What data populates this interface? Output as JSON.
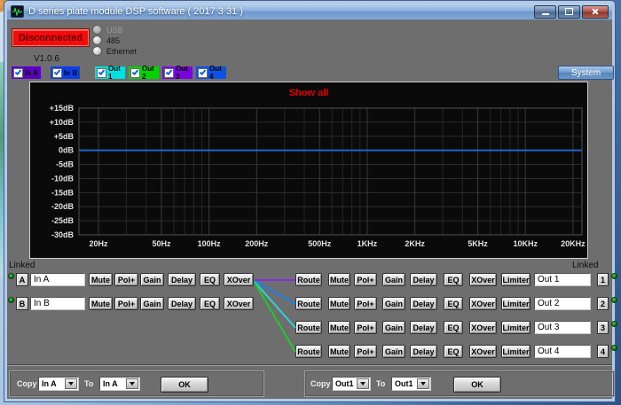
{
  "window": {
    "title": "D series plate module DSP software ( 2017 3 31 )"
  },
  "connection": {
    "status_label": "Disconnected",
    "version": "V1.0.6",
    "radio_options": [
      {
        "label": "USB",
        "enabled": false,
        "selected": false
      },
      {
        "label": "485",
        "enabled": true,
        "selected": false
      },
      {
        "label": "Ethernet",
        "enabled": true,
        "selected": false
      }
    ]
  },
  "channel_toggles": [
    {
      "label": "In A",
      "checked": true,
      "color": "#5c00c4"
    },
    {
      "label": "In B",
      "checked": true,
      "color": "#0a3fe8"
    },
    {
      "label": "Out 1",
      "checked": true,
      "color": "#00e0e0"
    },
    {
      "label": "Out 2",
      "checked": true,
      "color": "#00d400"
    },
    {
      "label": "Out 3",
      "checked": true,
      "color": "#7c00e4"
    },
    {
      "label": "Out 4",
      "checked": true,
      "color": "#0a52e8"
    }
  ],
  "system_button_label": "System",
  "graph": {
    "title": "Show all",
    "title_color": "#dd0000",
    "y_ticks": [
      {
        "label": "+15dB",
        "db": 15
      },
      {
        "label": "+10dB",
        "db": 10
      },
      {
        "label": "+5dB",
        "db": 5
      },
      {
        "label": "0dB",
        "db": 0
      },
      {
        "label": "-5dB",
        "db": -5
      },
      {
        "label": "-10dB",
        "db": -10
      },
      {
        "label": "-15dB",
        "db": -15
      },
      {
        "label": "-20dB",
        "db": -20
      },
      {
        "label": "-25dB",
        "db": -25
      },
      {
        "label": "-30dB",
        "db": -30
      }
    ],
    "x_ticks": [
      {
        "label": "20Hz",
        "f": 20
      },
      {
        "label": "50Hz",
        "f": 50
      },
      {
        "label": "100Hz",
        "f": 100
      },
      {
        "label": "200Hz",
        "f": 200
      },
      {
        "label": "500Hz",
        "f": 500
      },
      {
        "label": "1KHz",
        "f": 1000
      },
      {
        "label": "2KHz",
        "f": 2000
      },
      {
        "label": "5KHz",
        "f": 5000
      },
      {
        "label": "10KHz",
        "f": 10000
      },
      {
        "label": "20KHz",
        "f": 20000
      }
    ],
    "curve": {
      "db": 0,
      "color": "#1c64c8"
    }
  },
  "linked_left": "Linked",
  "linked_right": "Linked",
  "inputs": [
    {
      "id": "A",
      "name": "In A",
      "buttons": [
        "Mute",
        "Pol+",
        "Gain",
        "Delay",
        "EQ",
        "XOver"
      ]
    },
    {
      "id": "B",
      "name": "In B",
      "buttons": [
        "Mute",
        "Pol+",
        "Gain",
        "Delay",
        "EQ",
        "XOver"
      ]
    }
  ],
  "outputs": [
    {
      "id": "1",
      "name": "Out 1",
      "buttons": [
        "Route",
        "Mute",
        "Pol+",
        "Gain",
        "Delay",
        "EQ",
        "XOver",
        "Limiter"
      ]
    },
    {
      "id": "2",
      "name": "Out 2",
      "buttons": [
        "Route",
        "Mute",
        "Pol+",
        "Gain",
        "Delay",
        "EQ",
        "XOver",
        "Limiter"
      ]
    },
    {
      "id": "3",
      "name": "Out 3",
      "buttons": [
        "Route",
        "Mute",
        "Pol+",
        "Gain",
        "Delay",
        "EQ",
        "XOver",
        "Limiter"
      ]
    },
    {
      "id": "4",
      "name": "Out 4",
      "buttons": [
        "Route",
        "Mute",
        "Pol+",
        "Gain",
        "Delay",
        "EQ",
        "XOver",
        "Limiter"
      ]
    }
  ],
  "routing_lines": [
    {
      "from": "In A",
      "to": "Out 1",
      "color": "#8a2be2"
    },
    {
      "from": "In A",
      "to": "Out 2",
      "color": "#1e7fe8"
    },
    {
      "from": "In A",
      "to": "Out 3",
      "color": "#27d6d6"
    },
    {
      "from": "In A",
      "to": "Out 4",
      "color": "#1ecb2a"
    }
  ],
  "copy_input": {
    "label": "Copy",
    "from_value": "In A",
    "to_label": "To",
    "to_value": "In A",
    "ok_label": "OK"
  },
  "copy_output": {
    "label": "Copy",
    "from_value": "Out1",
    "to_label": "To",
    "to_value": "Out1",
    "ok_label": "OK"
  }
}
